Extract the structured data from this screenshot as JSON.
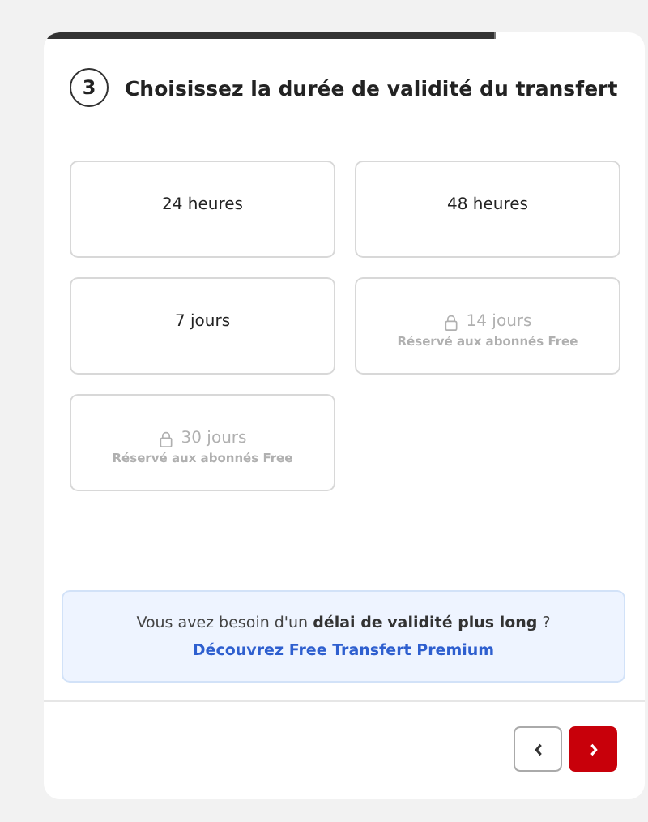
{
  "step": {
    "number": "3",
    "title": "Choisissez la durée de validité du transfert"
  },
  "options": [
    {
      "label": "24 heures",
      "disabled": false,
      "selected": false
    },
    {
      "label": "48 heures",
      "disabled": false,
      "selected": false
    },
    {
      "label": "7 jours",
      "disabled": false,
      "selected": false
    },
    {
      "label": "14 jours",
      "disabled": true,
      "selected": false,
      "note": "Réservé aux abonnés Free"
    },
    {
      "label": "30 jours",
      "disabled": true,
      "selected": false,
      "note": "Réservé aux abonnés Free"
    }
  ],
  "banner": {
    "text": "Vous avez besoin d'un **délai de validité plus long** ?",
    "link": "Découvrez Free Transfert Premium"
  },
  "nav": {
    "back_disabled": false,
    "next_disabled": false
  }
}
